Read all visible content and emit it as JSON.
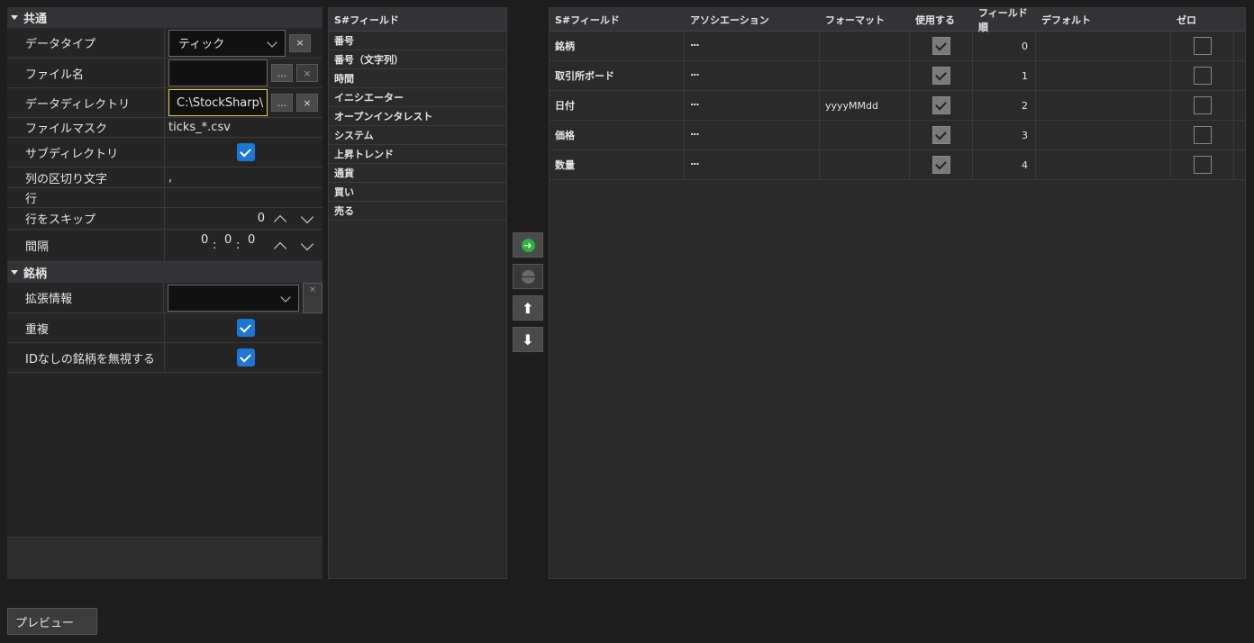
{
  "props": {
    "categories": {
      "common": "共通",
      "security": "銘柄"
    },
    "rows": {
      "data_type": {
        "label": "データタイプ",
        "value": "ティック"
      },
      "file_name": {
        "label": "ファイル名",
        "value": ""
      },
      "data_dir": {
        "label": "データディレクトリ",
        "value": "C:\\StockSharp\\"
      },
      "file_mask": {
        "label": "ファイルマスク",
        "value": "ticks_*.csv"
      },
      "subdirs": {
        "label": "サブディレクトリ",
        "checked": true
      },
      "col_sep": {
        "label": "列の区切り文字",
        "value": ","
      },
      "line": {
        "label": "行",
        "value": ""
      },
      "skip": {
        "label": "行をスキップ",
        "value": "0"
      },
      "interval": {
        "label": "間隔",
        "h": "0",
        "m": "0",
        "s": "0",
        "sep": ":"
      },
      "ext_info": {
        "label": "拡張情報",
        "value": ""
      },
      "dup": {
        "label": "重複",
        "checked": true
      },
      "ignore_noid": {
        "label": "IDなしの銘柄を無視する",
        "checked": true
      }
    },
    "buttons": {
      "ellipsis": "...",
      "clear": "×"
    }
  },
  "field_list": {
    "header": "S#フィールド",
    "items": [
      "番号",
      "番号（文字列）",
      "時間",
      "イニシエーター",
      "オープンインタレスト",
      "システム",
      "上昇トレンド",
      "通貨",
      "買い",
      "売る"
    ]
  },
  "mapping": {
    "headers": [
      "S#フィールド",
      "アソシエーション",
      "フォーマット",
      "使用する",
      "フィールド順",
      "デフォルト",
      "ゼロ"
    ],
    "rows": [
      {
        "field": "銘柄",
        "assoc": "...",
        "format": "",
        "use": true,
        "order": "0",
        "default": "",
        "zero": false
      },
      {
        "field": "取引所ボード",
        "assoc": "...",
        "format": "",
        "use": true,
        "order": "1",
        "default": "",
        "zero": false
      },
      {
        "field": "日付",
        "assoc": "...",
        "format": "yyyyMMdd",
        "use": true,
        "order": "2",
        "default": "",
        "zero": false
      },
      {
        "field": "価格",
        "assoc": "...",
        "format": "",
        "use": true,
        "order": "3",
        "default": "",
        "zero": false
      },
      {
        "field": "数量",
        "assoc": "...",
        "format": "",
        "use": true,
        "order": "4",
        "default": "",
        "zero": false
      }
    ]
  },
  "preview_label": "プレビュー"
}
